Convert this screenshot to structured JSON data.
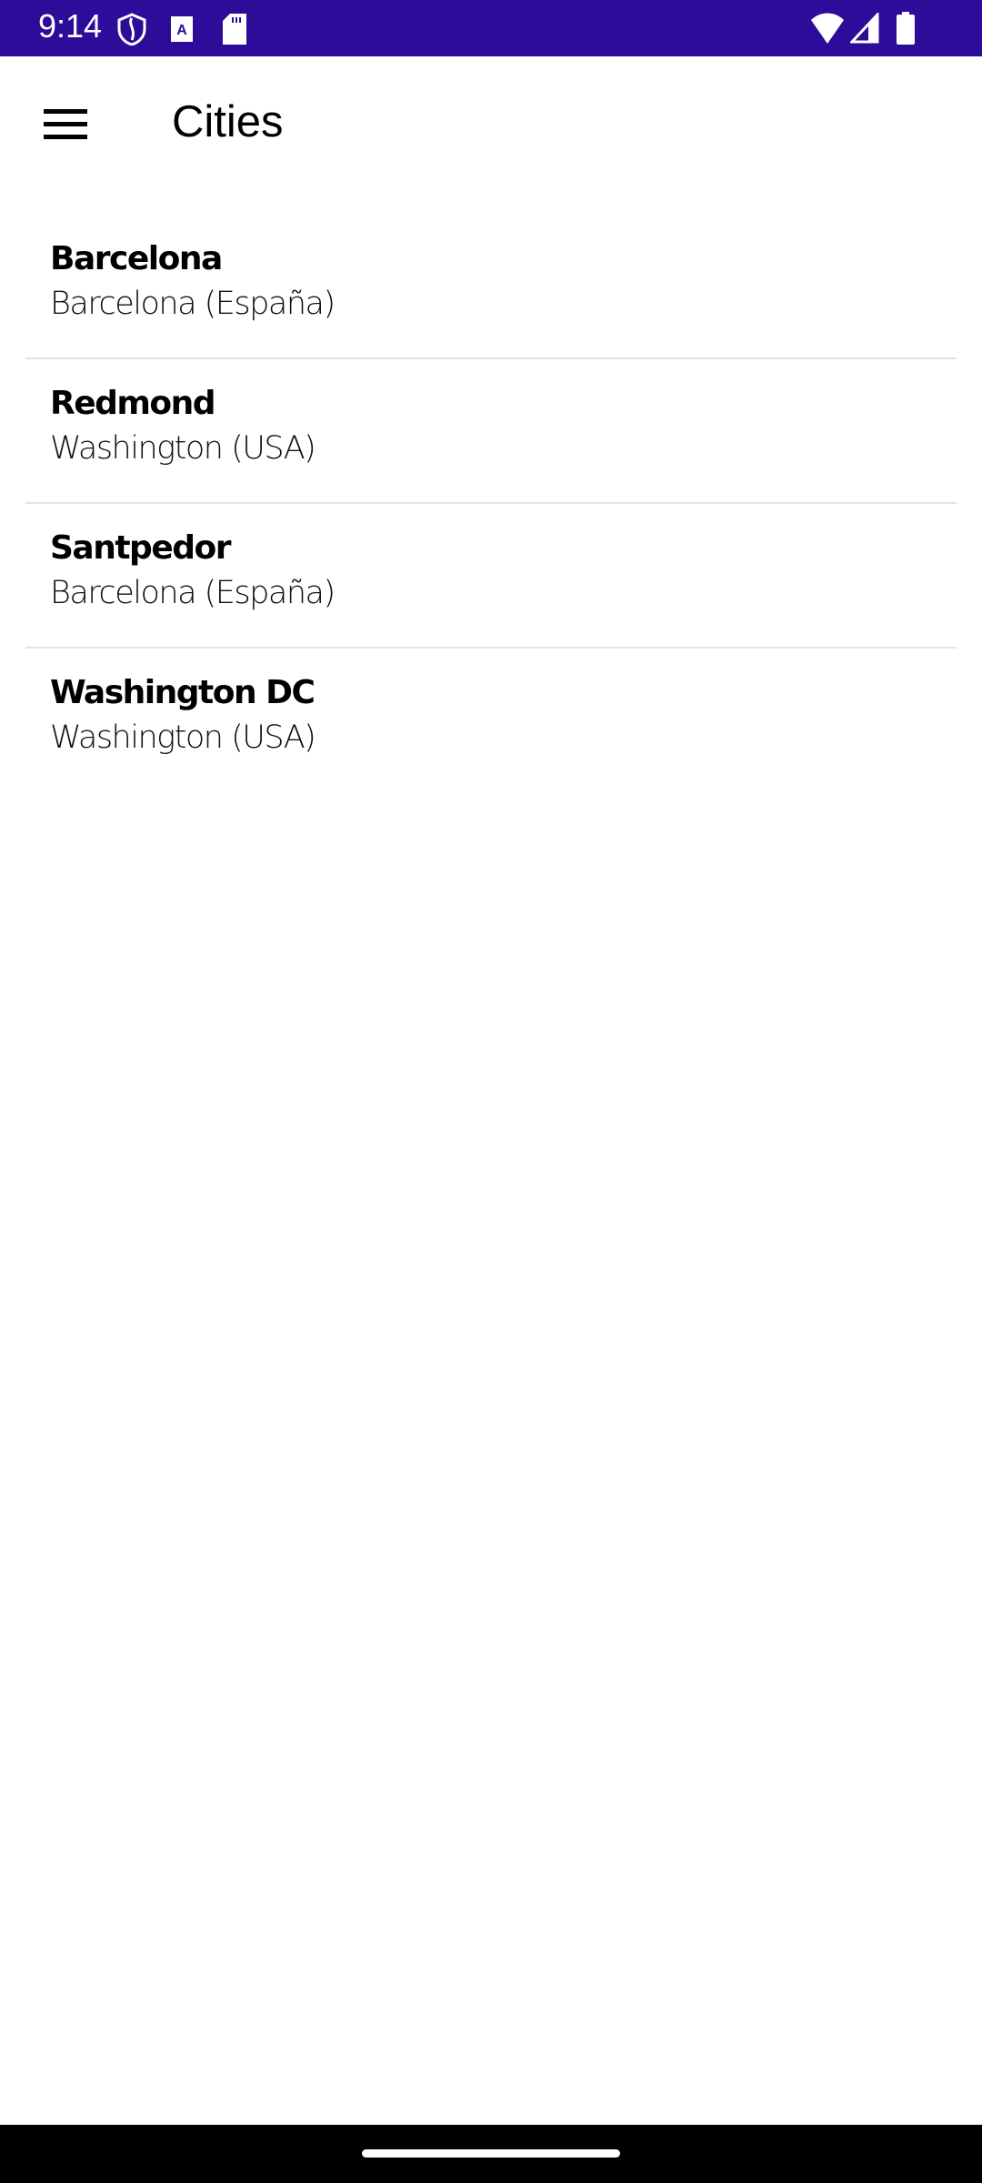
{
  "status_bar": {
    "time": "9:14",
    "icons": [
      "shield-icon",
      "keyboard-a-icon",
      "sd-card-icon",
      "wifi-icon",
      "signal-icon",
      "battery-icon"
    ],
    "color": "#2c0c99"
  },
  "app_bar": {
    "title": "Cities",
    "menu_icon": "hamburger-menu-icon"
  },
  "cities": [
    {
      "name": "Barcelona",
      "region": "Barcelona (España)"
    },
    {
      "name": "Redmond",
      "region": "Washington (USA)"
    },
    {
      "name": "Santpedor",
      "region": "Barcelona (España)"
    },
    {
      "name": "Washington DC",
      "region": "Washington (USA)"
    }
  ]
}
